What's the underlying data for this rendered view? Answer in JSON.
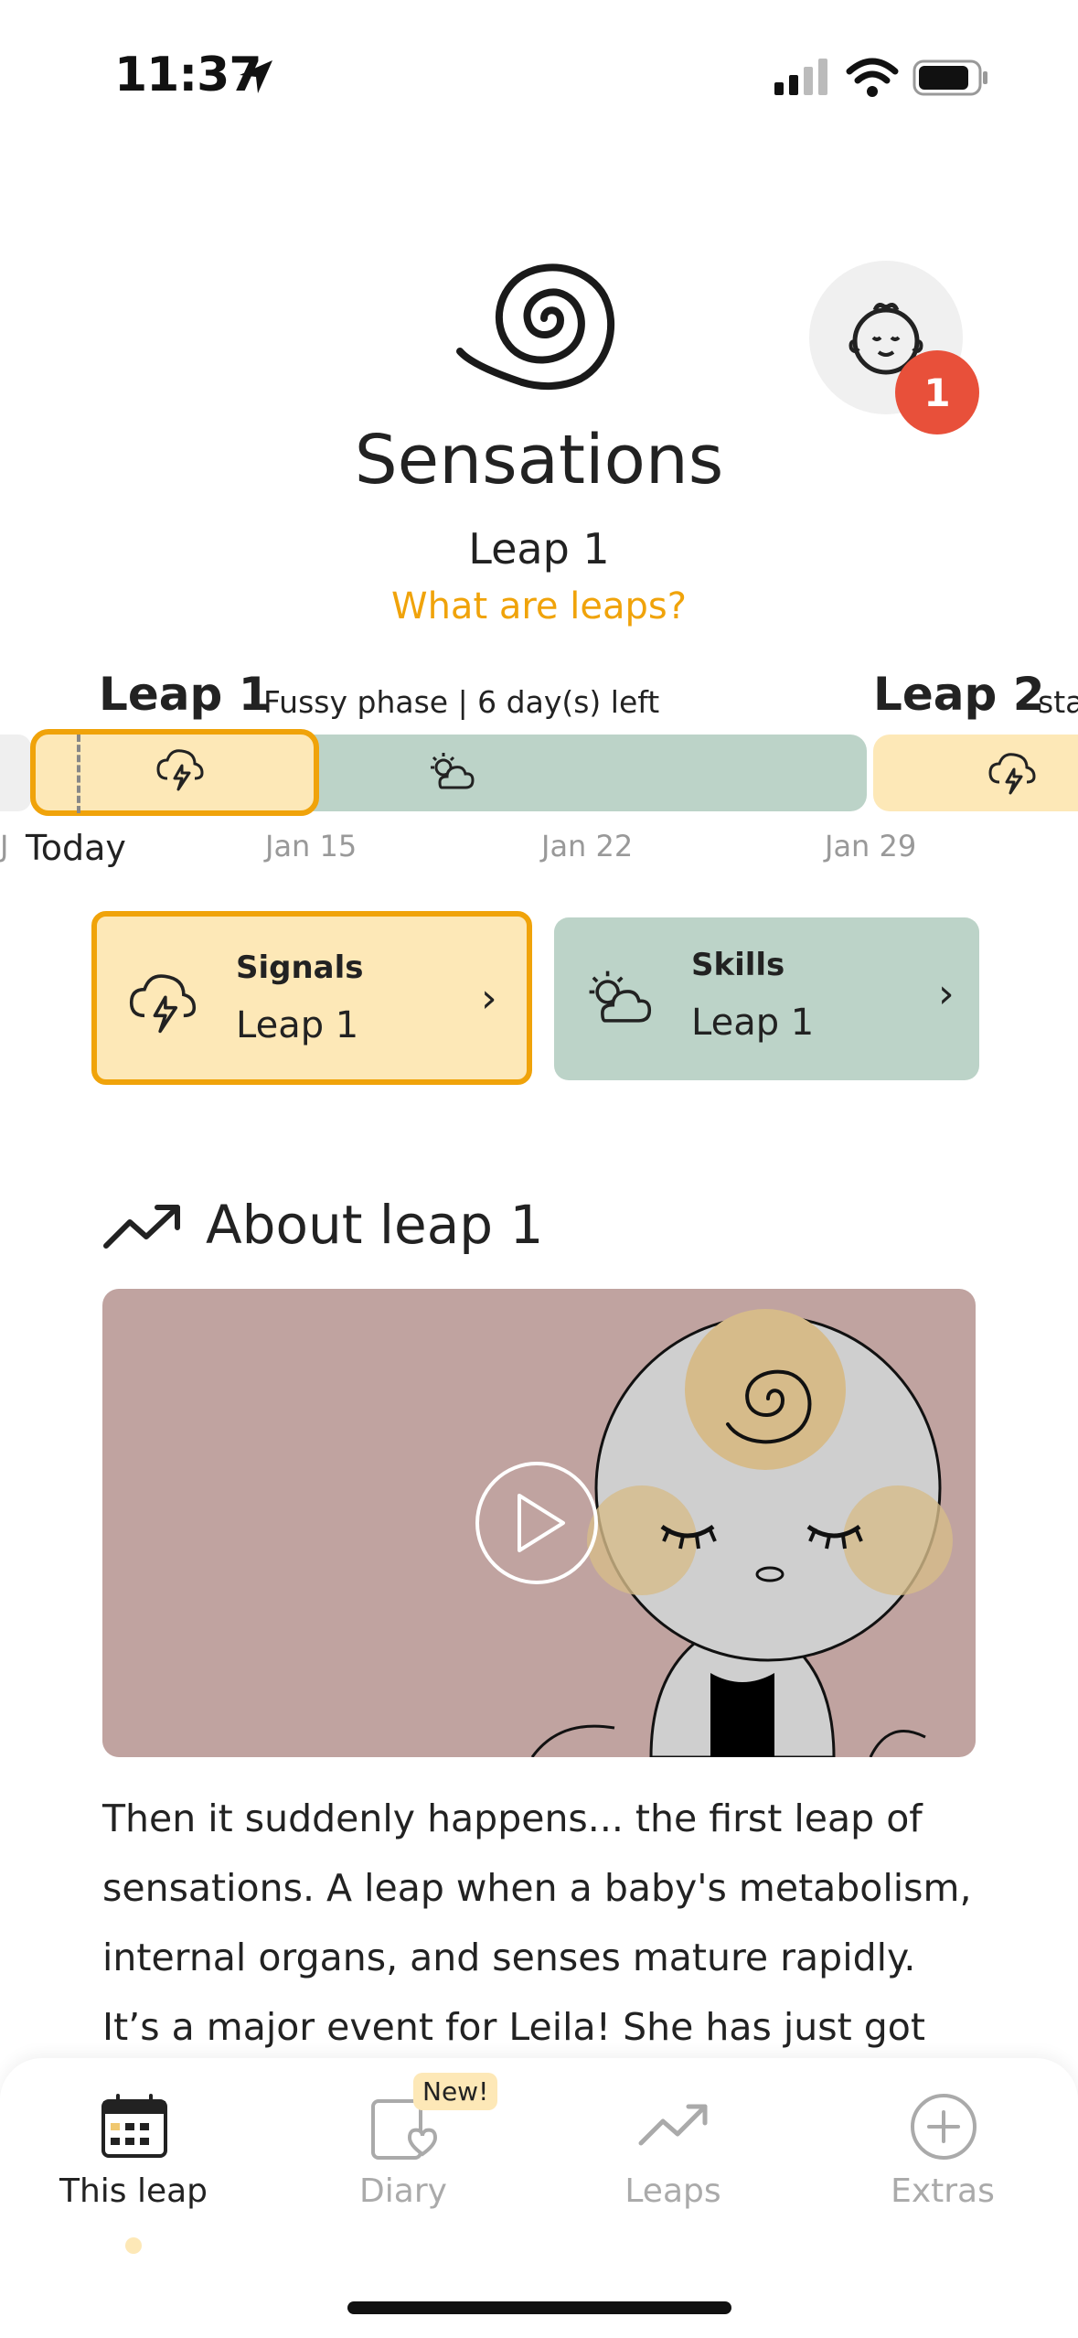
{
  "status_bar": {
    "time": "11:37"
  },
  "header": {
    "title": "Sensations",
    "subtitle": "Leap 1",
    "link": "What are leaps?",
    "notification_count": "1"
  },
  "timeline": {
    "leap1_label": "Leap 1",
    "leap1_phase": "Fussy phase | 6 day(s) left",
    "leap2_label": "Leap 2",
    "leap2_rest": "sta",
    "today_label": "Today",
    "dates": [
      "Jan 15",
      "Jan 22",
      "Jan 29"
    ],
    "cut_left": "J"
  },
  "cards": [
    {
      "title": "Signals",
      "sub": "Leap 1",
      "icon": "storm-cloud-icon"
    },
    {
      "title": "Skills",
      "sub": "Leap 1",
      "icon": "sun-cloud-icon"
    }
  ],
  "about": {
    "title": "About leap 1",
    "body": "Then it suddenly happens... the first leap of sensations. A leap when a baby's metabolism, internal organs, and senses mature rapidly. It’s a major event for Leila! She has just got used to"
  },
  "nav": {
    "items": [
      {
        "label": "This leap",
        "icon": "calendar-icon",
        "active": true
      },
      {
        "label": "Diary",
        "icon": "diary-heart-icon",
        "badge": "New!"
      },
      {
        "label": "Leaps",
        "icon": "trend-icon"
      },
      {
        "label": "Extras",
        "icon": "plus-circle-icon"
      }
    ]
  },
  "colors": {
    "accent": "#f0a30a",
    "leap_yellow": "#fde8b7",
    "skills_green": "#bcd3c8",
    "badge_red": "#e8503a",
    "video_bg": "#c0a3a0"
  }
}
